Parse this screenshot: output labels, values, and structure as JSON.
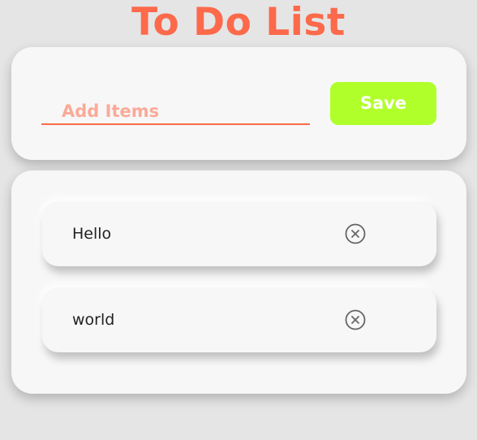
{
  "header": {
    "title": "To Do List"
  },
  "input_card": {
    "placeholder": "Add Items",
    "value": "",
    "save_label": "Save"
  },
  "todo_list": {
    "items": [
      {
        "text": "Hello",
        "remove_icon": "close-circle-icon"
      },
      {
        "text": "world",
        "remove_icon": "close-circle-icon"
      }
    ]
  },
  "colors": {
    "background": "#e5e5e5",
    "accent": "#fc6a4b",
    "placeholder": "#fbaa98",
    "save_button": "#b0ff2a",
    "card": "#f7f7f7",
    "icon": "#666666"
  }
}
